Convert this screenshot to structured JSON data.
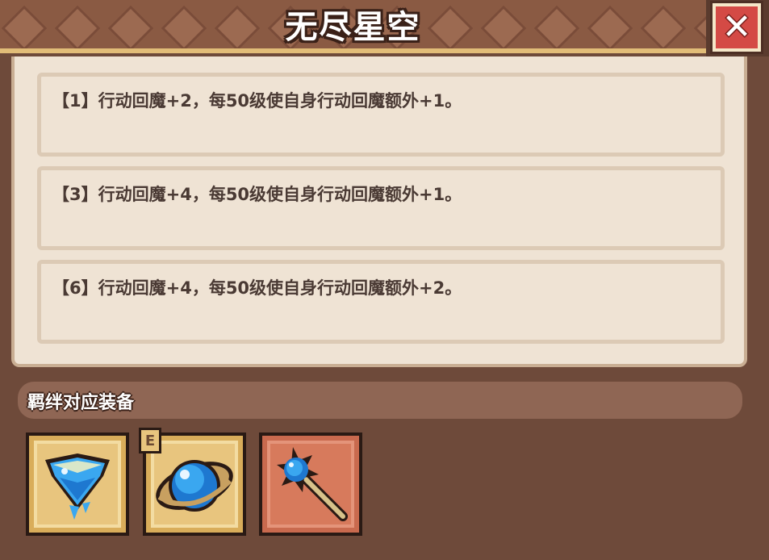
{
  "window": {
    "title": "无尽星空",
    "close_label": "✕"
  },
  "effects": [
    {
      "text": "【1】行动回魔+2，每50级使自身行动回魔额外+1。"
    },
    {
      "text": "【3】行动回魔+4，每50级使自身行动回魔额外+1。"
    },
    {
      "text": "【6】行动回魔+4，每50级使自身行动回魔额外+2。"
    }
  ],
  "equipment": {
    "header": "羁绊对应装备",
    "items": [
      {
        "icon": "blue-crystal-heart-icon",
        "frame": "gold"
      },
      {
        "icon": "blue-orb-ring-icon",
        "frame": "gold",
        "badge": "E"
      },
      {
        "icon": "star-scepter-icon",
        "frame": "red"
      }
    ]
  },
  "colors": {
    "frame_brown": "#6e4a3a",
    "panel_cream": "#efe3d4",
    "text_dark": "#4a3a34",
    "close_red": "#d44a45",
    "slot_gold": "#e8c57e",
    "slot_red": "#d77a5c"
  }
}
